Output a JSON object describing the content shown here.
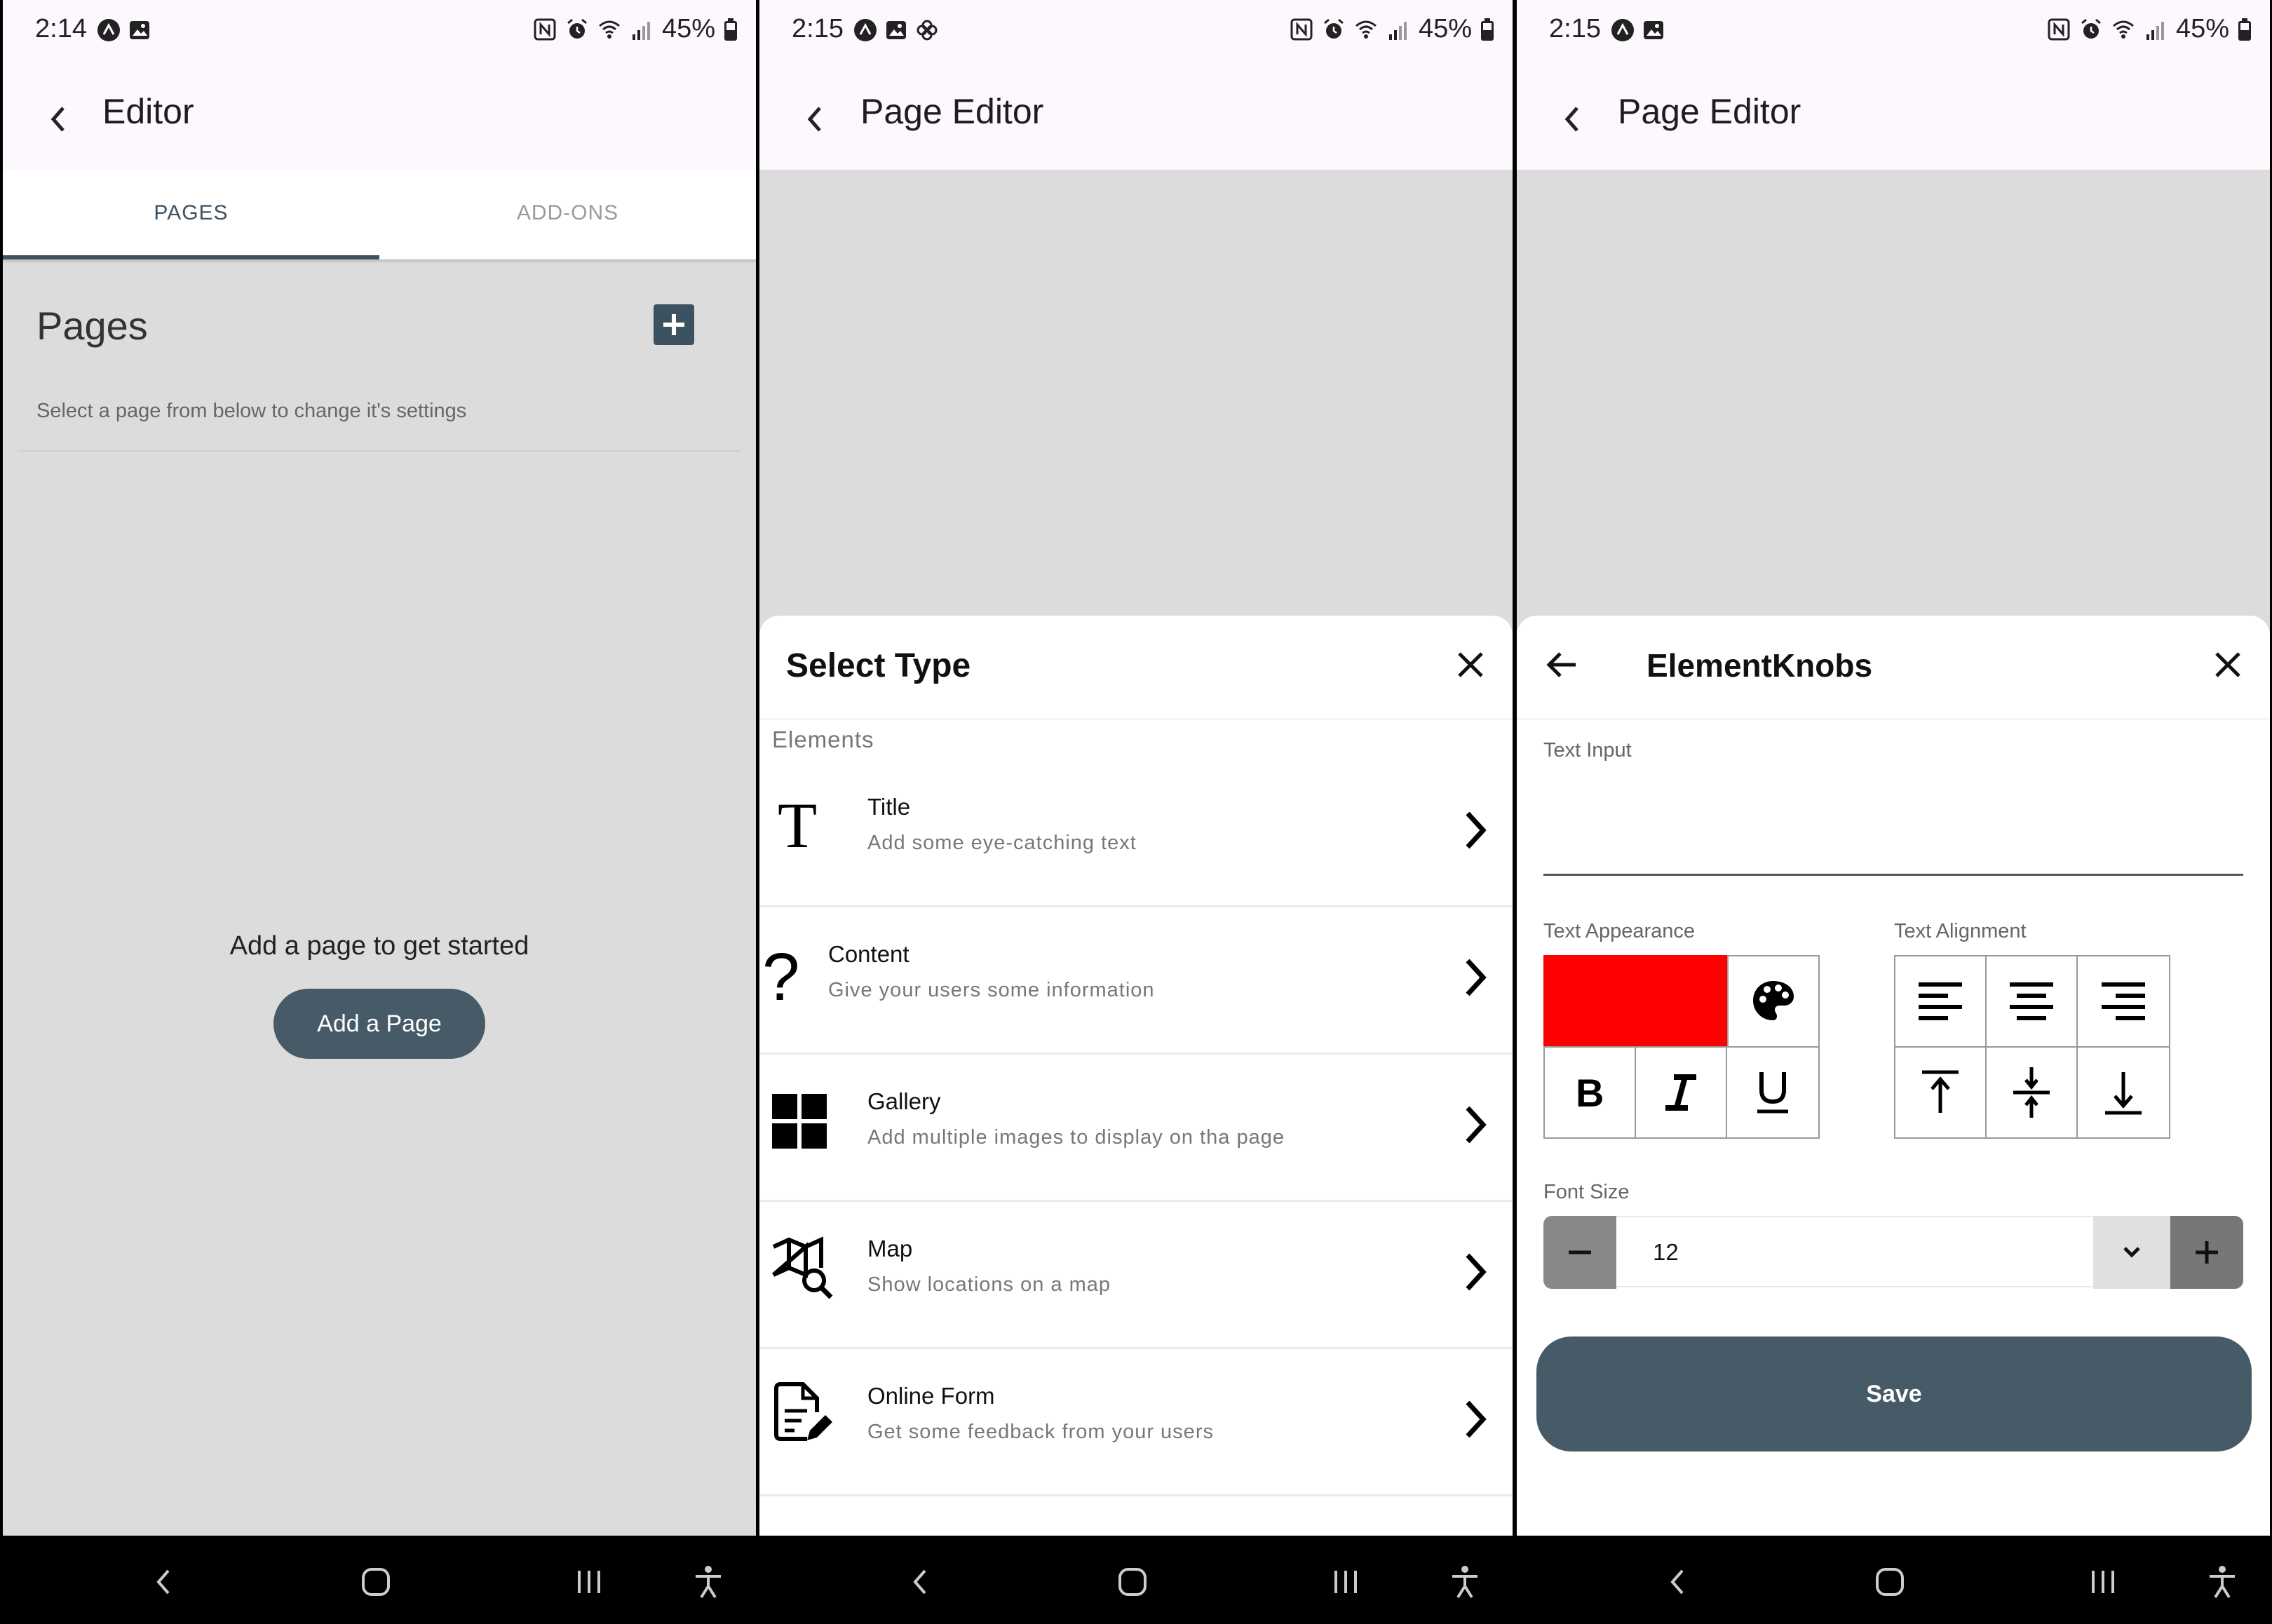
{
  "status": {
    "battery": "45%",
    "screen1_time": "2:14",
    "screen2_time": "2:15",
    "screen3_time": "2:15"
  },
  "screen1": {
    "appbar_title": "Editor",
    "tabs": [
      {
        "label": "PAGES"
      },
      {
        "label": "ADD-ONS"
      }
    ],
    "pages_heading": "Pages",
    "pages_subtitle": "Select a page from below to change it's settings",
    "empty_message": "Add a page to get started",
    "add_page_button": "Add a Page"
  },
  "screen2": {
    "appbar_title": "Page Editor",
    "sheet_title": "Select Type",
    "section_label": "Elements",
    "items": [
      {
        "title": "Title",
        "subtitle": "Add some eye-catching text",
        "icon": "text-t-icon"
      },
      {
        "title": "Content",
        "subtitle": "Give your users some information",
        "icon": "question-mark-icon"
      },
      {
        "title": "Gallery",
        "subtitle": "Add multiple images to display on tha page",
        "icon": "grid-icon"
      },
      {
        "title": "Map",
        "subtitle": "Show locations on a map",
        "icon": "map-search-icon"
      },
      {
        "title": "Online Form",
        "subtitle": "Get some feedback from your users",
        "icon": "form-edit-icon"
      }
    ]
  },
  "screen3": {
    "appbar_title": "Page Editor",
    "sheet_title": "ElementKnobs",
    "text_input_label": "Text Input",
    "text_input_value": "",
    "text_appearance_label": "Text Appearance",
    "text_alignment_label": "Text Alignment",
    "text_color": "#ff0000",
    "font_size_label": "Font Size",
    "font_size_value": "12",
    "save_button": "Save",
    "style_buttons": [
      "B",
      "I",
      "U"
    ]
  },
  "colors": {
    "primary": "#465a68",
    "tab_active": "#3d5261",
    "background": "#dcdcdc",
    "swatch": "#ff0000"
  }
}
